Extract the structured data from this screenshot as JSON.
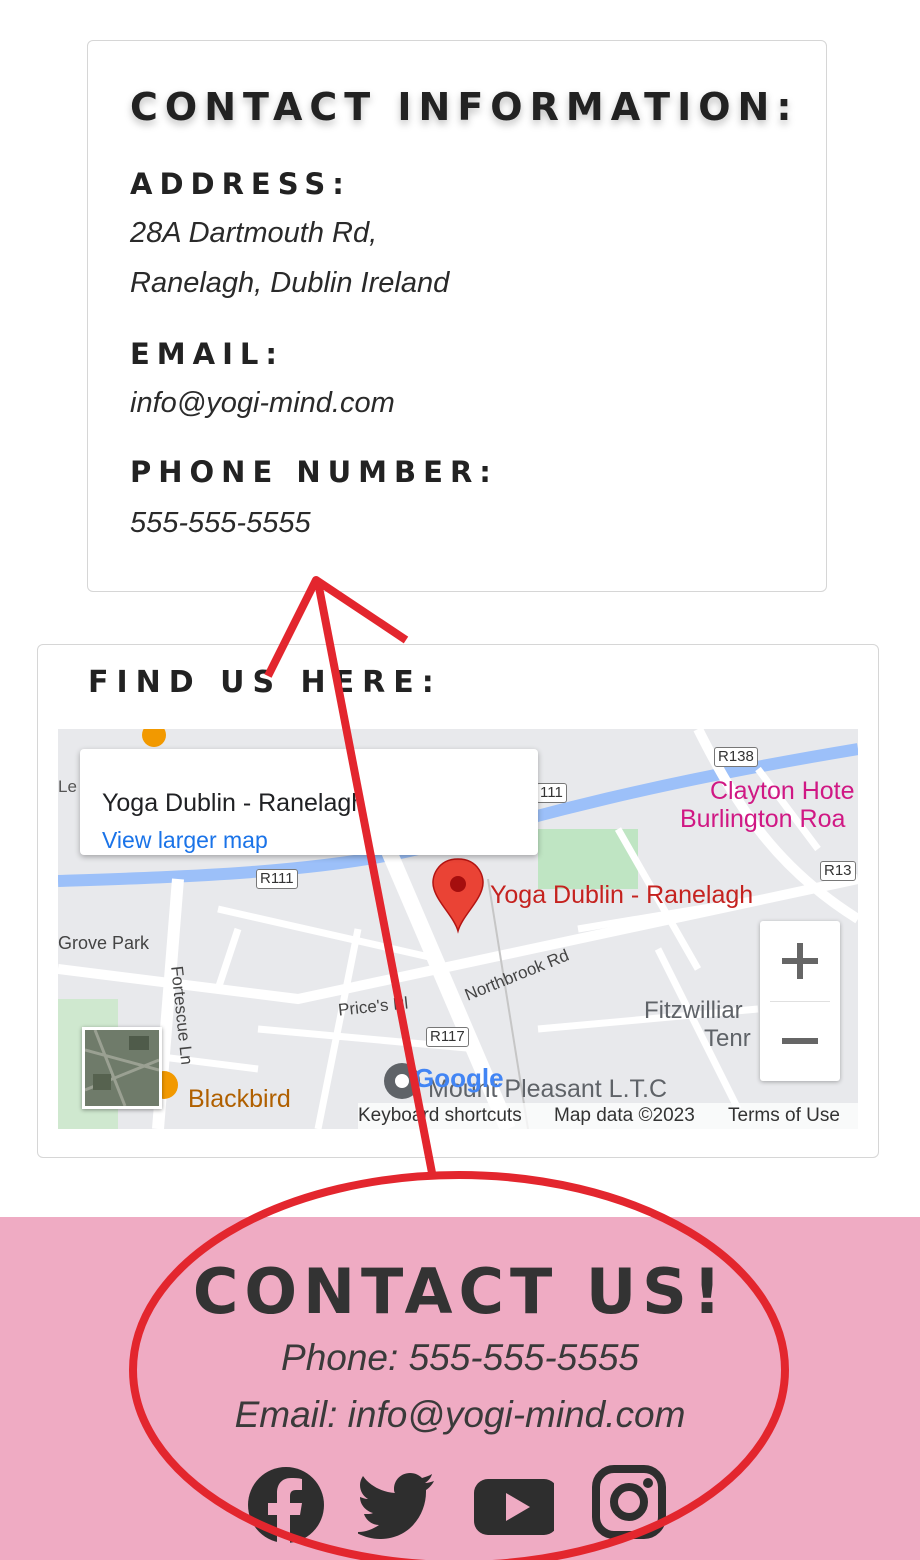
{
  "contact_info": {
    "title": "CONTACT INFORMATION:",
    "address_label": "ADDRESS:",
    "address_line1": "28A Dartmouth Rd,",
    "address_line2": "Ranelagh, Dublin Ireland",
    "email_label": "EMAIL:",
    "email_value": "info@yogi-mind.com",
    "phone_label": "PHONE NUMBER:",
    "phone_value": "555-555-5555"
  },
  "map_section": {
    "title": "FIND US HERE:",
    "info_window": {
      "place_name": "Yoga Dublin - Ranelagh",
      "link": "View larger map"
    },
    "pin_label": "Yoga Dublin - Ranelagh",
    "labels": {
      "clayton_1": "Clayton Hote",
      "clayton_2": "Burlington Roa",
      "grove_park": "Grove Park",
      "fortescue": "Fortescue Ln",
      "prices_pl": "Price's Pl",
      "northbrook": "Northbrook Rd",
      "fitzwilliam_1": "Fitzwilliar",
      "fitzwilliam_2": "Tenr",
      "blackbird": "Blackbird",
      "mount_pleasant": "Mount Pleasant L.T.C",
      "left_edge": "Le",
      "google": "Google"
    },
    "road_shields": {
      "r138_top": "R138",
      "r111_top": "111",
      "r111": "R111",
      "r138_right": "R13",
      "r117": "R117"
    },
    "zoom_in": "+",
    "zoom_out": "−",
    "attribution": {
      "keyboard": "Keyboard shortcuts",
      "map_data": "Map data ©2023",
      "terms": "Terms of Use"
    }
  },
  "footer": {
    "title": "CONTACT US!",
    "phone_line": "Phone: 555-555-5555",
    "email_line": "Email: info@yogi-mind.com",
    "social_icons": [
      "facebook-icon",
      "twitter-icon",
      "youtube-icon",
      "instagram-icon"
    ],
    "background_color": "#efabc3"
  },
  "annotation_color": "#e3262e"
}
